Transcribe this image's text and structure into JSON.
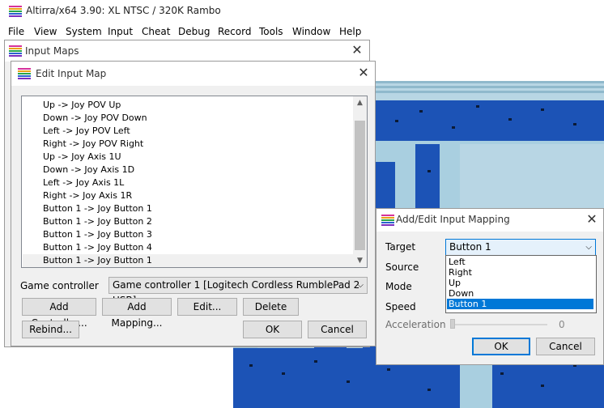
{
  "app": {
    "title": "Altirra/x64 3.90: XL NTSC / 320K Rambo",
    "menu": [
      "File",
      "View",
      "System",
      "Input",
      "Cheat",
      "Debug",
      "Record",
      "Tools",
      "Window",
      "Help"
    ]
  },
  "input_maps": {
    "title": "Input Maps",
    "close": "✕"
  },
  "edit_input_map": {
    "title": "Edit Input Map",
    "close": "✕",
    "mappings": [
      "Up -> Joy POV Up",
      "Down -> Joy POV Down",
      "Left -> Joy POV Left",
      "Right -> Joy POV Right",
      "Up -> Joy Axis 1U",
      "Down -> Joy Axis 1D",
      "Left -> Joy Axis 1L",
      "Right -> Joy Axis 1R",
      "Button 1 -> Joy Button 1",
      "Button 1 -> Joy Button 2",
      "Button 1 -> Joy Button 3",
      "Button 1 -> Joy Button 4",
      "Button 1 -> Joy Button 1"
    ],
    "selected_index": 12,
    "game_controller_label": "Game controller",
    "game_controller_value": "Game controller 1 [Logitech Cordless RumblePad 2 USB]",
    "buttons": {
      "add_controller": "Add Controller...",
      "add_mapping": "Add Mapping...",
      "edit": "Edit...",
      "delete": "Delete",
      "rebind": "Rebind...",
      "ok": "OK",
      "cancel": "Cancel"
    }
  },
  "add_edit_mapping": {
    "title": "Add/Edit Input Mapping",
    "close": "✕",
    "target_label": "Target",
    "target_value": "Button 1",
    "target_options": [
      "Left",
      "Right",
      "Up",
      "Down",
      "Button 1"
    ],
    "target_selected_index": 4,
    "source_label": "Source",
    "mode_label": "Mode",
    "speed_label": "Speed",
    "acceleration_label": "Acceleration",
    "acceleration_value": "0",
    "ok": "OK",
    "cancel": "Cancel"
  },
  "colors": {
    "accent": "#0078d7",
    "screen_light": "#b8d6e4",
    "screen_blue": "#1c53b6",
    "screen_dark": "#0b1a35"
  }
}
